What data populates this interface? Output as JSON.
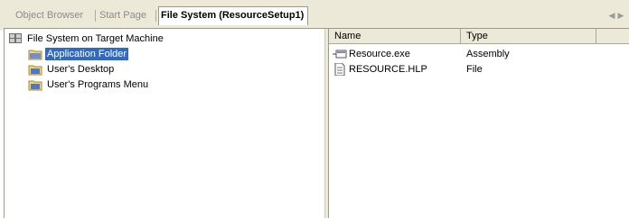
{
  "tabs": [
    {
      "label": "Object Browser",
      "active": false
    },
    {
      "label": "Start Page",
      "active": false
    },
    {
      "label": "File System (ResourceSetup1)",
      "active": true
    }
  ],
  "tab_nav": {
    "left_icon": "arrow-left-icon",
    "right_icon": "arrow-right-icon"
  },
  "tree": {
    "root": {
      "label": "File System on Target Machine",
      "icon": "file-system-icon"
    },
    "children": [
      {
        "label": "Application Folder",
        "icon": "folder-icon",
        "selected": true
      },
      {
        "label": "User's Desktop",
        "icon": "folder-icon",
        "selected": false
      },
      {
        "label": "User's Programs Menu",
        "icon": "folder-icon",
        "selected": false
      }
    ]
  },
  "list": {
    "columns": [
      "Name",
      "Type"
    ],
    "rows": [
      {
        "name": "Resource.exe",
        "type": "Assembly",
        "icon": "shortcut-icon"
      },
      {
        "name": "RESOURCE.HLP",
        "type": "File",
        "icon": "document-icon"
      }
    ]
  },
  "colors": {
    "selection": "#316ac5",
    "chrome": "#ece9d8",
    "folder": "#f5d76e"
  }
}
